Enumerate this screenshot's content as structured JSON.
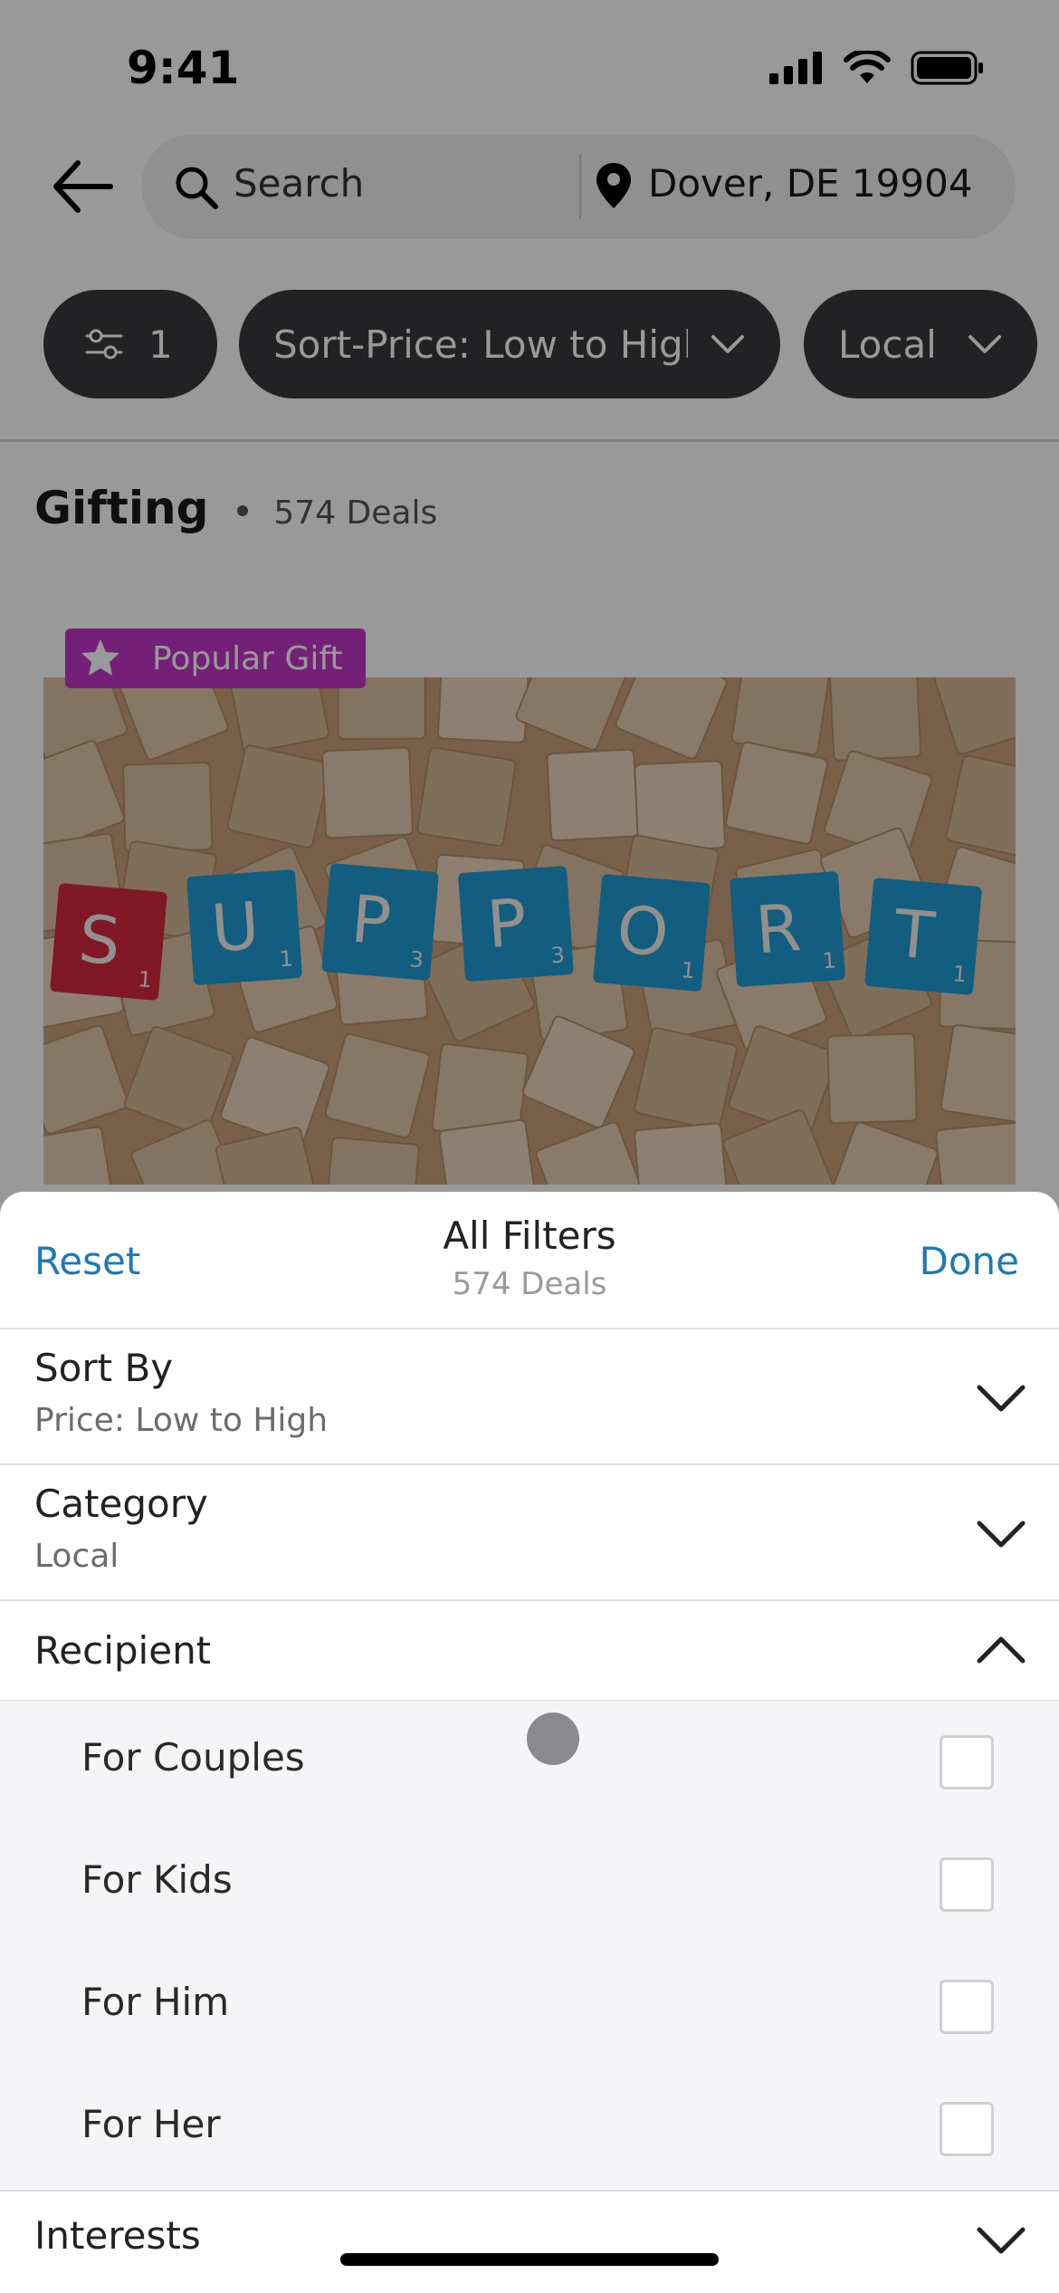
{
  "status_bar": {
    "time": "9:41"
  },
  "search": {
    "placeholder": "Search",
    "location": "Dover, DE 19904"
  },
  "chips": {
    "filter_count": "1",
    "sort": "Sort-Price: Low to High",
    "category": "Local"
  },
  "section": {
    "title": "Gifting",
    "count": "574 Deals"
  },
  "deal": {
    "badge": "Popular Gift",
    "image_letters": [
      "S",
      "U",
      "P",
      "P",
      "O",
      "R",
      "T"
    ],
    "image_subscripts": [
      "1",
      "1",
      "3",
      "3",
      "1",
      "1",
      "1"
    ]
  },
  "sheet": {
    "reset_label": "Reset",
    "title": "All Filters",
    "subtitle": "574 Deals",
    "done_label": "Done",
    "sort_by": {
      "label": "Sort By",
      "value": "Price: Low to High"
    },
    "category": {
      "label": "Category",
      "value": "Local"
    },
    "recipient": {
      "label": "Recipient",
      "options": [
        {
          "label": "For Couples",
          "checked": false
        },
        {
          "label": "For Kids",
          "checked": false
        },
        {
          "label": "For Him",
          "checked": false
        },
        {
          "label": "For Her",
          "checked": false
        }
      ]
    },
    "interests": {
      "label": "Interests"
    }
  },
  "colors": {
    "accent": "#1f78b4",
    "chip_bg": "#3a3a3e",
    "badge_bg": "#c236c8",
    "tile_blue": "#1f9bd6",
    "tile_red": "#d8283f"
  }
}
